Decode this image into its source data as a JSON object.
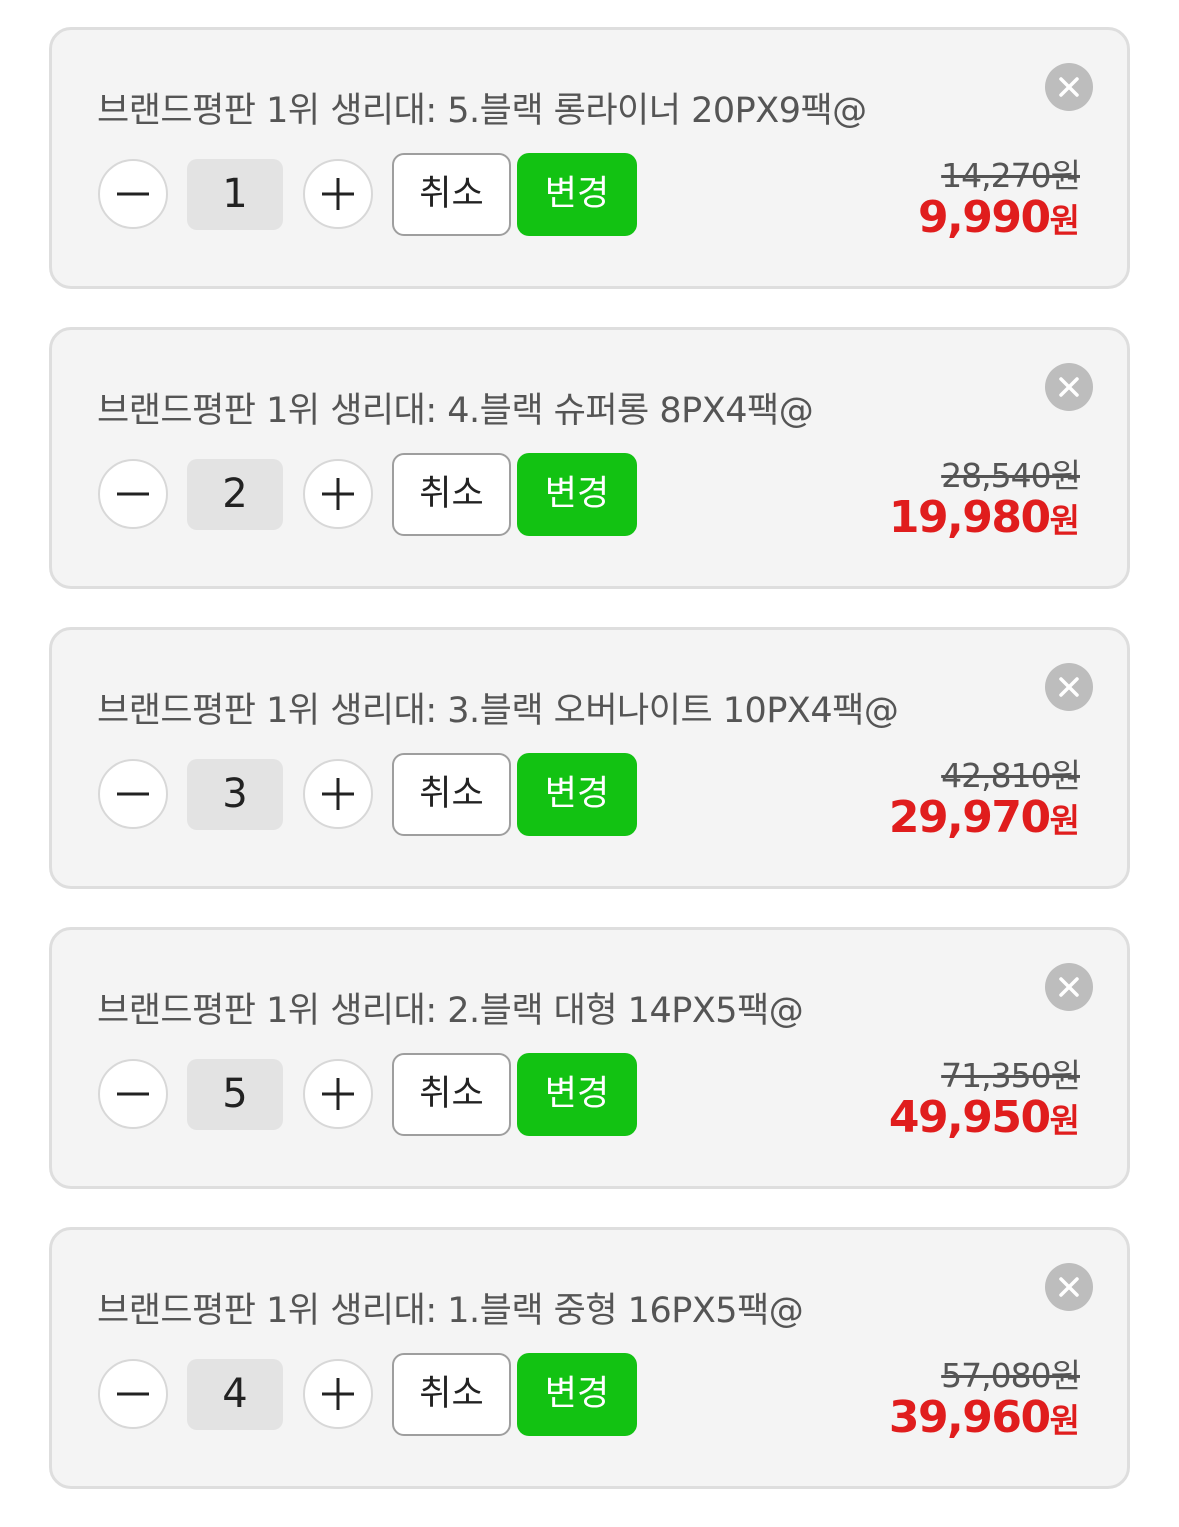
{
  "items": [
    {
      "title": "브랜드평판 1위 생리대: 5.블랙 롱라이너 20PX9팩@",
      "quantity": "1",
      "cancel_label": "취소",
      "change_label": "변경",
      "original_price": "14,270원",
      "sale_price": "9,990",
      "currency": "원"
    },
    {
      "title": "브랜드평판 1위 생리대: 4.블랙 슈퍼롱 8PX4팩@",
      "quantity": "2",
      "cancel_label": "취소",
      "change_label": "변경",
      "original_price": "28,540원",
      "sale_price": "19,980",
      "currency": "원"
    },
    {
      "title": "브랜드평판 1위 생리대: 3.블랙 오버나이트 10PX4팩@",
      "quantity": "3",
      "cancel_label": "취소",
      "change_label": "변경",
      "original_price": "42,810원",
      "sale_price": "29,970",
      "currency": "원"
    },
    {
      "title": "브랜드평판 1위 생리대: 2.블랙 대형 14PX5팩@",
      "quantity": "5",
      "cancel_label": "취소",
      "change_label": "변경",
      "original_price": "71,350원",
      "sale_price": "49,950",
      "currency": "원"
    },
    {
      "title": "브랜드평판 1위 생리대: 1.블랙 중형 16PX5팩@",
      "quantity": "4",
      "cancel_label": "취소",
      "change_label": "변경",
      "original_price": "57,080원",
      "sale_price": "39,960",
      "currency": "원"
    }
  ],
  "colors": {
    "change_button": "#12c212",
    "sale_price": "#e01d1d",
    "card_background": "#f4f4f4",
    "close_button": "#bdbdbd"
  },
  "icons": {
    "close": "close-icon",
    "decrease": "minus-icon",
    "increase": "plus-icon"
  }
}
